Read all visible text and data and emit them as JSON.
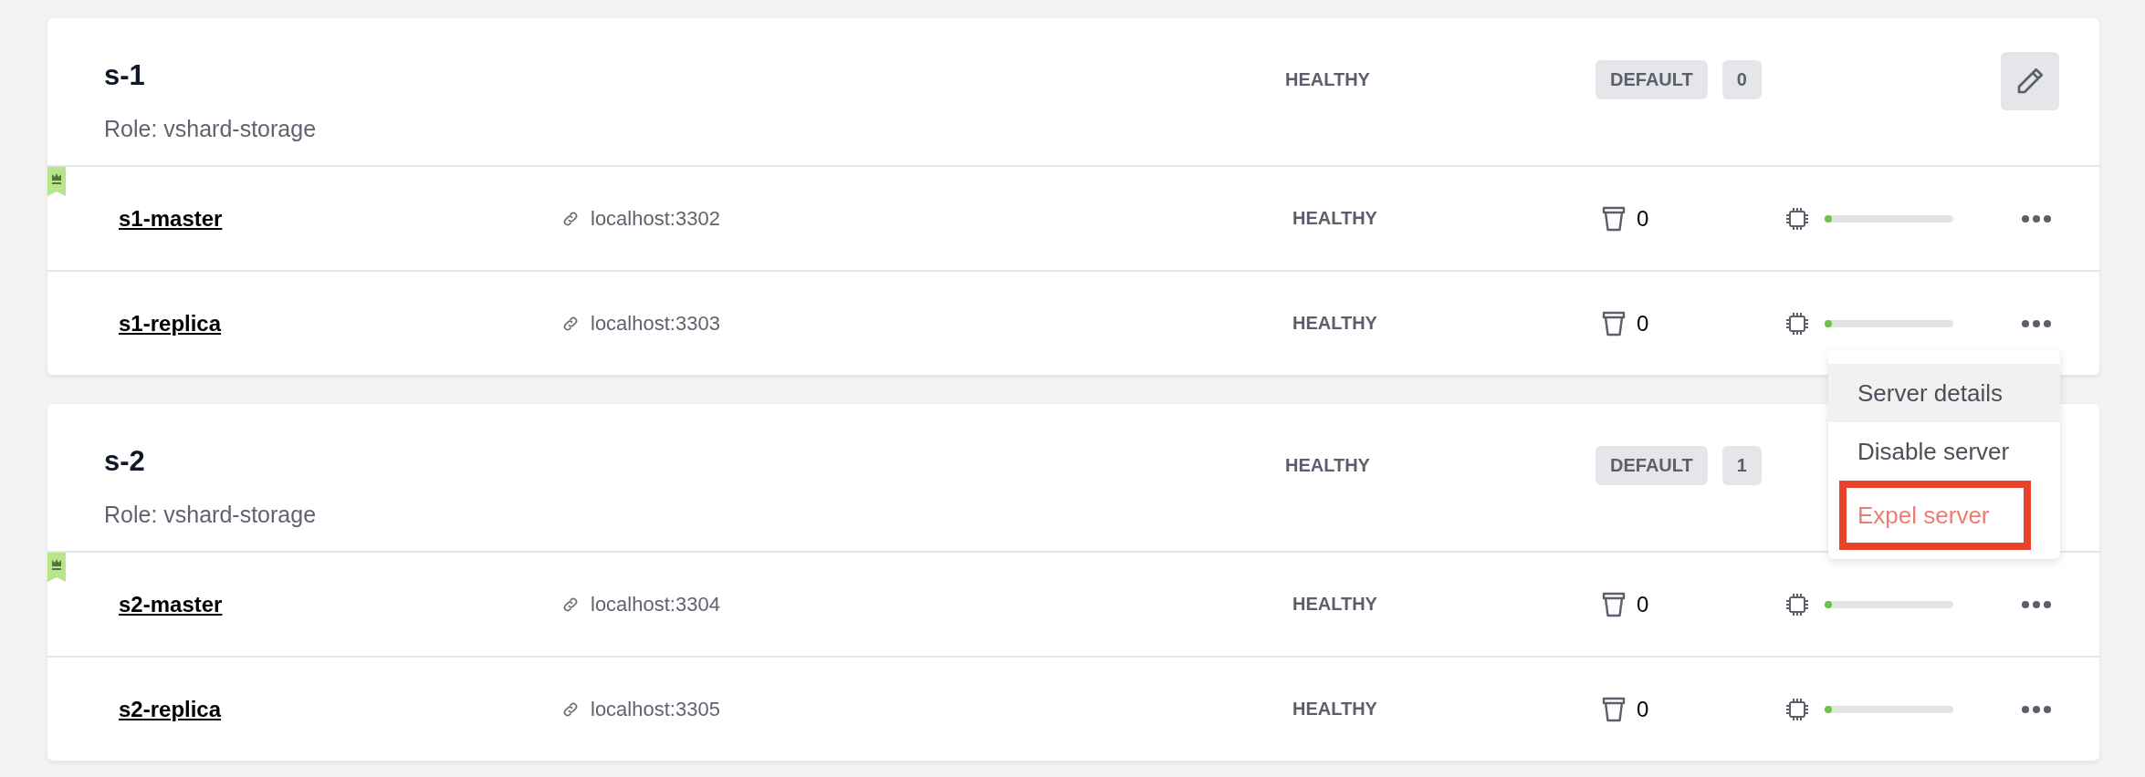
{
  "shards": [
    {
      "name": "s-1",
      "role": "Role: vshard-storage",
      "status": "HEALTHY",
      "group": "DEFAULT",
      "weight": "0",
      "edit_button": true,
      "servers": [
        {
          "name": "s1-master",
          "master": true,
          "address": "localhost:3302",
          "status": "HEALTHY",
          "buckets": "0",
          "level": 0.04
        },
        {
          "name": "s1-replica",
          "master": false,
          "address": "localhost:3303",
          "status": "HEALTHY",
          "buckets": "0",
          "level": 0.04
        }
      ]
    },
    {
      "name": "s-2",
      "role": "Role: vshard-storage",
      "status": "HEALTHY",
      "group": "DEFAULT",
      "weight": "1",
      "edit_button": false,
      "servers": [
        {
          "name": "s2-master",
          "master": true,
          "address": "localhost:3304",
          "status": "HEALTHY",
          "buckets": "0",
          "level": 0.04
        },
        {
          "name": "s2-replica",
          "master": false,
          "address": "localhost:3305",
          "status": "HEALTHY",
          "buckets": "0",
          "level": 0.04
        }
      ]
    }
  ],
  "context_menu": {
    "items": [
      {
        "label": "Server details",
        "kind": "normal",
        "hovered": true,
        "highlighted": false
      },
      {
        "label": "Disable server",
        "kind": "normal",
        "hovered": false,
        "highlighted": false
      },
      {
        "label": "Expel server",
        "kind": "danger",
        "hovered": false,
        "highlighted": true
      }
    ]
  }
}
